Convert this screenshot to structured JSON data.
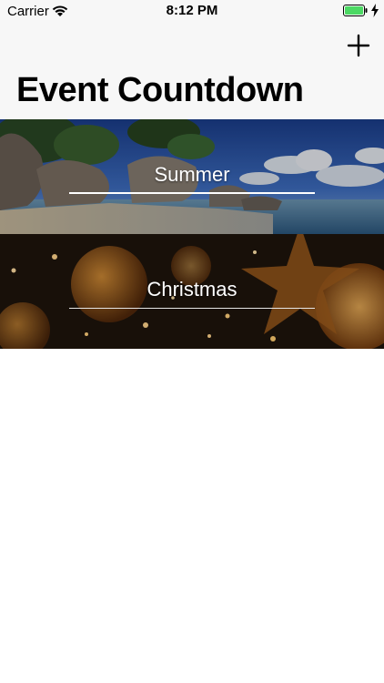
{
  "status_bar": {
    "carrier": "Carrier",
    "time": "8:12 PM",
    "battery_color": "#4cd964"
  },
  "nav": {
    "title": "Event Countdown",
    "add_icon": "plus-icon"
  },
  "events": [
    {
      "name": "Summer",
      "background": "beach-photo"
    },
    {
      "name": "Christmas",
      "background": "ornaments-photo"
    }
  ]
}
